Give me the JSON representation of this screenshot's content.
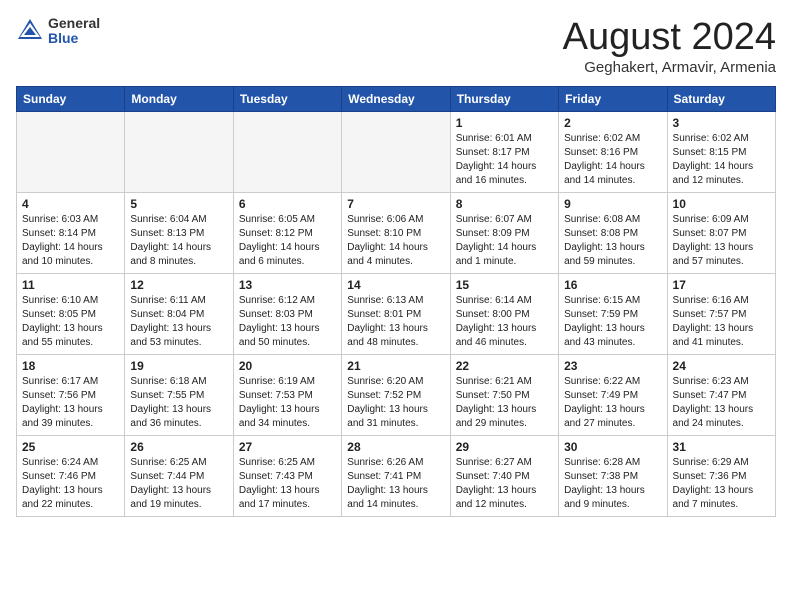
{
  "header": {
    "logo_general": "General",
    "logo_blue": "Blue",
    "title": "August 2024",
    "location": "Geghakert, Armavir, Armenia"
  },
  "days_of_week": [
    "Sunday",
    "Monday",
    "Tuesday",
    "Wednesday",
    "Thursday",
    "Friday",
    "Saturday"
  ],
  "weeks": [
    [
      {
        "num": "",
        "info": ""
      },
      {
        "num": "",
        "info": ""
      },
      {
        "num": "",
        "info": ""
      },
      {
        "num": "",
        "info": ""
      },
      {
        "num": "1",
        "info": "Sunrise: 6:01 AM\nSunset: 8:17 PM\nDaylight: 14 hours\nand 16 minutes."
      },
      {
        "num": "2",
        "info": "Sunrise: 6:02 AM\nSunset: 8:16 PM\nDaylight: 14 hours\nand 14 minutes."
      },
      {
        "num": "3",
        "info": "Sunrise: 6:02 AM\nSunset: 8:15 PM\nDaylight: 14 hours\nand 12 minutes."
      }
    ],
    [
      {
        "num": "4",
        "info": "Sunrise: 6:03 AM\nSunset: 8:14 PM\nDaylight: 14 hours\nand 10 minutes."
      },
      {
        "num": "5",
        "info": "Sunrise: 6:04 AM\nSunset: 8:13 PM\nDaylight: 14 hours\nand 8 minutes."
      },
      {
        "num": "6",
        "info": "Sunrise: 6:05 AM\nSunset: 8:12 PM\nDaylight: 14 hours\nand 6 minutes."
      },
      {
        "num": "7",
        "info": "Sunrise: 6:06 AM\nSunset: 8:10 PM\nDaylight: 14 hours\nand 4 minutes."
      },
      {
        "num": "8",
        "info": "Sunrise: 6:07 AM\nSunset: 8:09 PM\nDaylight: 14 hours\nand 1 minute."
      },
      {
        "num": "9",
        "info": "Sunrise: 6:08 AM\nSunset: 8:08 PM\nDaylight: 13 hours\nand 59 minutes."
      },
      {
        "num": "10",
        "info": "Sunrise: 6:09 AM\nSunset: 8:07 PM\nDaylight: 13 hours\nand 57 minutes."
      }
    ],
    [
      {
        "num": "11",
        "info": "Sunrise: 6:10 AM\nSunset: 8:05 PM\nDaylight: 13 hours\nand 55 minutes."
      },
      {
        "num": "12",
        "info": "Sunrise: 6:11 AM\nSunset: 8:04 PM\nDaylight: 13 hours\nand 53 minutes."
      },
      {
        "num": "13",
        "info": "Sunrise: 6:12 AM\nSunset: 8:03 PM\nDaylight: 13 hours\nand 50 minutes."
      },
      {
        "num": "14",
        "info": "Sunrise: 6:13 AM\nSunset: 8:01 PM\nDaylight: 13 hours\nand 48 minutes."
      },
      {
        "num": "15",
        "info": "Sunrise: 6:14 AM\nSunset: 8:00 PM\nDaylight: 13 hours\nand 46 minutes."
      },
      {
        "num": "16",
        "info": "Sunrise: 6:15 AM\nSunset: 7:59 PM\nDaylight: 13 hours\nand 43 minutes."
      },
      {
        "num": "17",
        "info": "Sunrise: 6:16 AM\nSunset: 7:57 PM\nDaylight: 13 hours\nand 41 minutes."
      }
    ],
    [
      {
        "num": "18",
        "info": "Sunrise: 6:17 AM\nSunset: 7:56 PM\nDaylight: 13 hours\nand 39 minutes."
      },
      {
        "num": "19",
        "info": "Sunrise: 6:18 AM\nSunset: 7:55 PM\nDaylight: 13 hours\nand 36 minutes."
      },
      {
        "num": "20",
        "info": "Sunrise: 6:19 AM\nSunset: 7:53 PM\nDaylight: 13 hours\nand 34 minutes."
      },
      {
        "num": "21",
        "info": "Sunrise: 6:20 AM\nSunset: 7:52 PM\nDaylight: 13 hours\nand 31 minutes."
      },
      {
        "num": "22",
        "info": "Sunrise: 6:21 AM\nSunset: 7:50 PM\nDaylight: 13 hours\nand 29 minutes."
      },
      {
        "num": "23",
        "info": "Sunrise: 6:22 AM\nSunset: 7:49 PM\nDaylight: 13 hours\nand 27 minutes."
      },
      {
        "num": "24",
        "info": "Sunrise: 6:23 AM\nSunset: 7:47 PM\nDaylight: 13 hours\nand 24 minutes."
      }
    ],
    [
      {
        "num": "25",
        "info": "Sunrise: 6:24 AM\nSunset: 7:46 PM\nDaylight: 13 hours\nand 22 minutes."
      },
      {
        "num": "26",
        "info": "Sunrise: 6:25 AM\nSunset: 7:44 PM\nDaylight: 13 hours\nand 19 minutes."
      },
      {
        "num": "27",
        "info": "Sunrise: 6:25 AM\nSunset: 7:43 PM\nDaylight: 13 hours\nand 17 minutes."
      },
      {
        "num": "28",
        "info": "Sunrise: 6:26 AM\nSunset: 7:41 PM\nDaylight: 13 hours\nand 14 minutes."
      },
      {
        "num": "29",
        "info": "Sunrise: 6:27 AM\nSunset: 7:40 PM\nDaylight: 13 hours\nand 12 minutes."
      },
      {
        "num": "30",
        "info": "Sunrise: 6:28 AM\nSunset: 7:38 PM\nDaylight: 13 hours\nand 9 minutes."
      },
      {
        "num": "31",
        "info": "Sunrise: 6:29 AM\nSunset: 7:36 PM\nDaylight: 13 hours\nand 7 minutes."
      }
    ]
  ]
}
